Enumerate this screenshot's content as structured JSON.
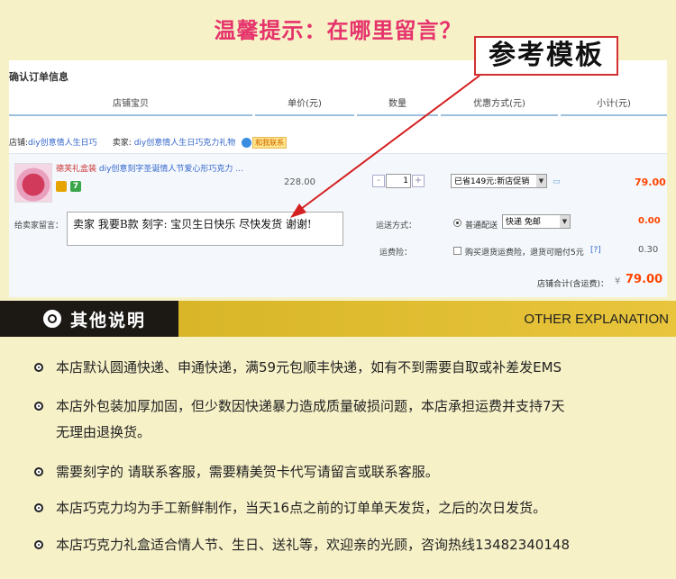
{
  "header": {
    "tip_title": "温馨提示：在哪里留言？",
    "template_label": "参考模板"
  },
  "order": {
    "panel_title": "确认订单信息",
    "columns": [
      "店铺宝贝",
      "单价(元)",
      "数量",
      "优惠方式(元)",
      "小计(元)"
    ],
    "shop_label": "店铺:",
    "shop_name": "diy创意情人生日巧",
    "seller_label": "卖家:",
    "seller_name": "diy创意情人生日巧克力礼物",
    "contact_label": "和我联系",
    "item": {
      "shop_tag": "德芙礼盒装",
      "title": "diy创意刻字圣诞情人节爱心形巧克力 ...",
      "badge2": "7",
      "price": "228.00",
      "quantity": "1",
      "qty_minus": "-",
      "qty_plus": "+",
      "promotion": "已省149元:新店促销",
      "subtotal": "79.00"
    },
    "message": {
      "label": "给卖家留言：",
      "value": "卖家 我要B款 刻字: 宝贝生日快乐 尽快发货 谢谢!"
    },
    "shipping": {
      "label": "运送方式：",
      "method": "普通配送",
      "option": "快递 免邮",
      "fee": "0.00"
    },
    "insurance": {
      "label": "运费险：",
      "text": "购买退货运费险，退货可赔付5元",
      "help": "[?]",
      "fee": "0.30"
    },
    "total": {
      "label": "店铺合计(含运费)：",
      "currency": "¥",
      "value": "79.00"
    }
  },
  "banner": {
    "title": "其他说明",
    "english": "OTHER EXPLANATION"
  },
  "notes": [
    "本店默认圆通快递、申通快递，满59元包顺丰快递，如有不到需要自取或补差发EMS",
    "本店外包装加厚加固，但少数因快递暴力造成质量破损问题，本店承担运费并支持7天",
    "无理由退换货。",
    "需要刻字的 请联系客服，需要精美贺卡代写请留言或联系客服。",
    "本店巧克力均为手工新鲜制作，当天16点之前的订单单天发货，之后的次日发货。",
    "本店巧克力礼盒适合情人节、生日、送礼等，欢迎亲的光顾，咨询热线13482340148"
  ],
  "colors": {
    "tip": "#e5336b",
    "accent_price": "#ff4400",
    "banner_dark": "#1c1914",
    "banner_gold": "#e0bd33",
    "background": "#f7f1c8"
  }
}
